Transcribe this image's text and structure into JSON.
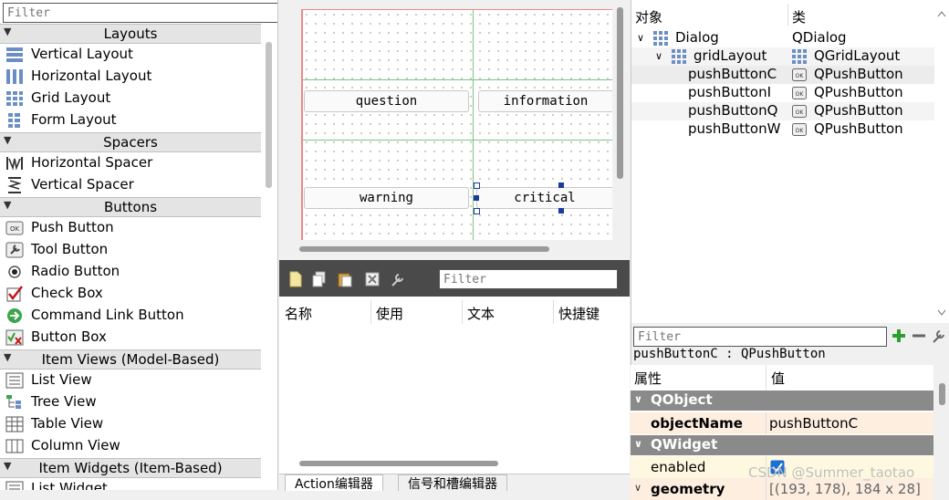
{
  "widget_box": {
    "filter_placeholder": "Filter",
    "categories": [
      {
        "label": "Layouts",
        "items": [
          "Vertical Layout",
          "Horizontal Layout",
          "Grid Layout",
          "Form Layout"
        ]
      },
      {
        "label": "Spacers",
        "items": [
          "Horizontal Spacer",
          "Vertical Spacer"
        ]
      },
      {
        "label": "Buttons",
        "items": [
          "Push Button",
          "Tool Button",
          "Radio Button",
          "Check Box",
          "Command Link Button",
          "Button Box"
        ]
      },
      {
        "label": "Item Views (Model-Based)",
        "items": [
          "List View",
          "Tree View",
          "Table View",
          "Column View"
        ]
      },
      {
        "label": "Item Widgets (Item-Based)",
        "items": [
          "List Widget"
        ]
      }
    ]
  },
  "form": {
    "buttons": [
      "question",
      "information",
      "warning",
      "critical"
    ]
  },
  "action_editor": {
    "filter_placeholder": "Filter",
    "columns": [
      "名称",
      "使用",
      "文本",
      "快捷键"
    ],
    "tabs": [
      "Action编辑器",
      "信号和槽编辑器"
    ]
  },
  "object_inspector": {
    "headers": [
      "对象",
      "类"
    ],
    "rows": [
      {
        "object": "Dialog",
        "class": "QDialog"
      },
      {
        "object": "gridLayout",
        "class": "QGridLayout"
      },
      {
        "object": "pushButtonC",
        "class": "QPushButton"
      },
      {
        "object": "pushButtonI",
        "class": "QPushButton"
      },
      {
        "object": "pushButtonQ",
        "class": "QPushButton"
      },
      {
        "object": "pushButtonW",
        "class": "QPushButton"
      }
    ]
  },
  "property_editor": {
    "filter_placeholder": "Filter",
    "title": "pushButtonC : QPushButton",
    "headers": [
      "属性",
      "值"
    ],
    "group_qobject": "QObject",
    "objectname_label": "objectName",
    "objectname_value": "pushButtonC",
    "group_qwidget": "QWidget",
    "enabled_label": "enabled",
    "enabled_checked": true,
    "geometry_label": "geometry",
    "geometry_value": "[(193, 178), 184 x 28]"
  },
  "watermark": "CSDN @Summer_taotao",
  "colors": {
    "group_header": "#8a8a8a",
    "property_row": "#fdeee0",
    "toolbar": "#4a4a4a",
    "grid_line": "#7bc47b",
    "add_icon": "#2e9e2e"
  }
}
